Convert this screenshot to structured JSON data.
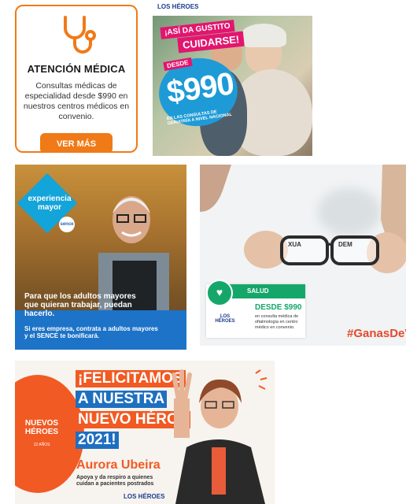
{
  "card_medica": {
    "title": "ATENCIÓN MÉDICA",
    "description": "Consultas médicas de especialidad desde $990 en nuestros centros médicos en convenio.",
    "button": "VER MÁS",
    "icon": "stethoscope-icon",
    "accent": "#f07a18"
  },
  "card_cuidarse": {
    "brand": "LOS HÉROES",
    "tag1": "¡ASÍ DA GUSTITO",
    "tag2": "CUIDARSE!",
    "desde": "DESDE",
    "price": "$990",
    "note": "EN LAS CONSULTAS DE GERIATRÍA A NIVEL NACIONAL",
    "accent": "#e2156f"
  },
  "card_experiencia": {
    "badge": "experiencia mayor",
    "sence": "sence",
    "headline": "Para que los adultos mayores que quieran trabajar, puedan hacerlo.",
    "cta": "Si eres empresa, contrata a adultos mayores y el SENCE te bonificará."
  },
  "card_salud": {
    "section": "SALUD",
    "brand": "LOS HÉROES",
    "desde": "DESDE $990",
    "description": "en consulta médica de oftalmología en centro médico en convenio.",
    "hashtag": "#GanasDeVi",
    "accent": "#15a76a"
  },
  "card_heroe": {
    "circle": "NUEVOS HÉROES",
    "circle_sub": "12 AÑOS",
    "line1": "¡FELICITAMOS",
    "line2": "A NUESTRA",
    "line3": "NUEVO HÉROE",
    "line4": "2021!",
    "name": "Aurora Ubeira",
    "subtitle": "Apoya y da respiro a quienes cuidan a pacientes postrados",
    "brand": "LOS HÉROES",
    "accent": "#f15a23",
    "blue": "#1f6fc0"
  }
}
